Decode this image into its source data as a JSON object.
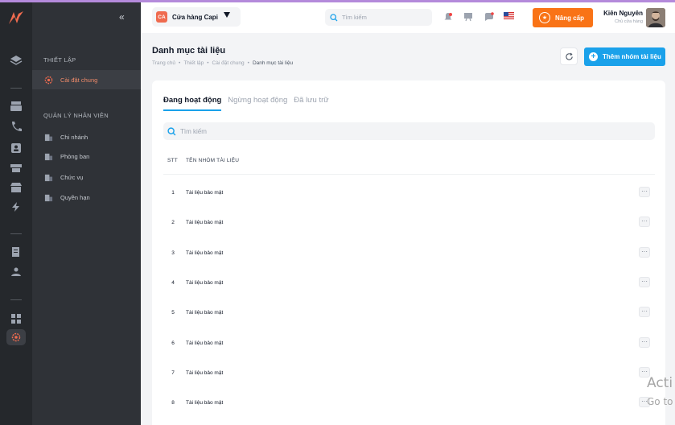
{
  "sidebar": {
    "sections": [
      {
        "title": "THIẾT LẬP"
      },
      {
        "title": "QUẢN LÝ NHÂN VIÊN"
      }
    ],
    "items": [
      {
        "label": "Cài đặt chung",
        "active": true,
        "icon": "settings-gear-icon"
      },
      {
        "label": "Chi nhánh",
        "active": false,
        "icon": "building-icon"
      },
      {
        "label": "Phòng ban",
        "active": false,
        "icon": "building-icon"
      },
      {
        "label": "Chức vụ",
        "active": false,
        "icon": "building-icon"
      },
      {
        "label": "Quyền hạn",
        "active": false,
        "icon": "building-icon"
      }
    ]
  },
  "topbar": {
    "store_badge": "CA",
    "store_name": "Cửa hàng Capi",
    "search_placeholder": "Tìm kiếm",
    "upgrade_label": "Nâng cấp",
    "user_name": "Kiên Nguyên",
    "user_role": "Chủ cửa hàng"
  },
  "page": {
    "title": "Danh mục tài liệu",
    "breadcrumb": [
      "Trang chủ",
      "Thiết lập",
      "Cài đặt chung",
      "Danh mục tài liệu"
    ],
    "add_button": "Thêm nhóm tài liệu"
  },
  "tabs": [
    {
      "label": "Đang hoạt động",
      "active": true
    },
    {
      "label": "Ngừng hoạt động",
      "active": false
    },
    {
      "label": "Đã lưu trữ",
      "active": false
    }
  ],
  "table": {
    "search_placeholder": "Tìm kiếm",
    "headers": [
      "STT",
      "TÊN NHÓM TÀI LIỆU"
    ],
    "rows": [
      {
        "stt": "1",
        "name": "Tài liệu bảo mật"
      },
      {
        "stt": "2",
        "name": "Tài liệu bảo mật"
      },
      {
        "stt": "3",
        "name": "Tài liệu bảo mật"
      },
      {
        "stt": "4",
        "name": "Tài liệu bảo mật"
      },
      {
        "stt": "5",
        "name": "Tài liệu bảo mật"
      },
      {
        "stt": "6",
        "name": "Tài liệu bảo mật"
      },
      {
        "stt": "7",
        "name": "Tài liệu bảo mật"
      },
      {
        "stt": "8",
        "name": "Tài liệu bảo mật"
      }
    ],
    "more_label": "···"
  },
  "watermark": {
    "line1": "Acti",
    "line2": "Go to"
  },
  "colors": {
    "accent": "#1aa1ea",
    "brand": "#f97316",
    "active_item": "#f08b6a"
  }
}
